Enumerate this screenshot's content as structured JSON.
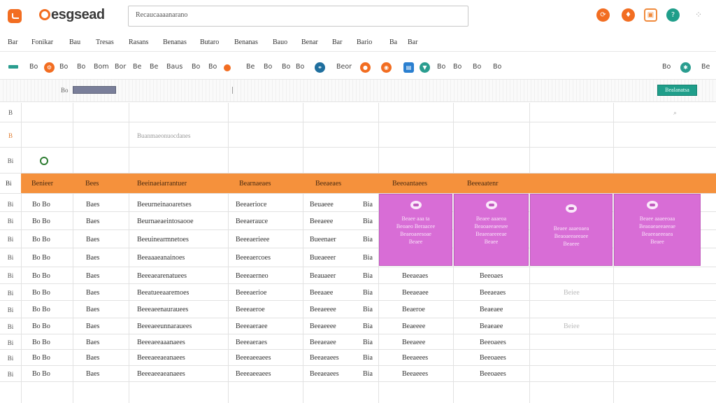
{
  "app": {
    "brand": "esgsead",
    "search_value": "Recaucaaaanarano",
    "top_icons": [
      {
        "name": "sync-icon",
        "glyph": "⟳",
        "color": "#f26d21"
      },
      {
        "name": "bell-icon",
        "glyph": "♦",
        "color": "#f26d21"
      },
      {
        "name": "calendar-icon",
        "glyph": "▣",
        "color": "#f08a3c"
      },
      {
        "name": "help-icon",
        "glyph": "?",
        "color": "#1f9e8a"
      }
    ],
    "grid_glyph": "⁘"
  },
  "menu": [
    "Bar",
    "Fonikar",
    "Bau",
    "Tresas",
    "Rasans",
    "Benanas",
    "Butaro",
    "Benanas",
    "Bauo",
    "Benar",
    "Bar",
    "Bario",
    "Ba",
    "Bar"
  ],
  "toolbar": {
    "items": [
      "Bo",
      "Bo",
      "Bo",
      "Bo",
      "Bom",
      "Bor",
      "Be",
      "Be",
      "Baus",
      "Bo",
      "Bo",
      "Be",
      "Bo",
      "Bo",
      "Bo",
      "Beor",
      "Bo",
      "Bo",
      "Bo",
      "Bo",
      "Bo",
      "Bo",
      "Bo",
      "Bo",
      "Bo",
      "Be"
    ],
    "round_icons": [
      {
        "name": "format-paint-icon",
        "glyph": "⚙",
        "color": "#f26d21"
      },
      {
        "name": "link-icon",
        "glyph": "⚭",
        "color": "#1f6f9e"
      },
      {
        "name": "comment-icon",
        "glyph": "●",
        "color": "#f26d21"
      },
      {
        "name": "image-icon",
        "glyph": "◉",
        "color": "#f26d21"
      },
      {
        "name": "chart-icon",
        "glyph": "▤",
        "color": "#2a7fd0"
      },
      {
        "name": "filter-icon",
        "glyph": "▼",
        "color": "#2a9d8f"
      },
      {
        "name": "settings-icon",
        "glyph": "✱",
        "color": "#2a9d8f"
      }
    ]
  },
  "formula_bar": {
    "cell_ref": "Bo",
    "share_label": "Bealanatsa"
  },
  "sheet": {
    "row_numbers": [
      "B",
      "B",
      "Bi",
      "Bi",
      "Bi",
      "Bi",
      "Bi",
      "Bi",
      "Bi",
      "Bi",
      "Bi",
      "Bi",
      "Bi",
      "Bi"
    ],
    "pre_row_text": "Buanmaeonuocdanes",
    "header_row_label": "Bi",
    "headers": [
      "Benieer",
      "Bees",
      "Beeinaeiarrantuer",
      "Bearnaeaes",
      "Beeaeaes",
      "Beeoantaees",
      "Beeeaatenr"
    ],
    "rows": [
      [
        "Bo Bo",
        "Baes",
        "Beeurneinaoaretses",
        "Beeaerioce",
        "Beuaeee",
        "Bia",
        "",
        "",
        "",
        ""
      ],
      [
        "Bo Bo",
        "Baes",
        "Beurnaeaeintosaooe",
        "Beeaerauce",
        "Beeaeee",
        "Bia",
        "",
        "",
        "",
        ""
      ],
      [
        "Bo Bo",
        "Baes",
        "Beeuinearmnetoes",
        "Beeeaerieee",
        "Bueenaer",
        "Bia",
        "",
        "",
        "",
        ""
      ],
      [
        "Bo Bo",
        "Baes",
        "Beeaaaeanainoes",
        "Beeeaercoes",
        "Bueaeeer",
        "Bia",
        "",
        "",
        "",
        ""
      ],
      [
        "Bo Bo",
        "Baes",
        "Beeeaearenatuees",
        "Beeeaerneo",
        "Beauaeer",
        "Bia",
        "Beeaeaes",
        "Beeoaes",
        "",
        ""
      ],
      [
        "Bo Bo",
        "Baes",
        "Beeatueeaaremoes",
        "Beeeaerioe",
        "Beeaaee",
        "Bia",
        "Beeaeaee",
        "Beeaeaes",
        "Beiee",
        ""
      ],
      [
        "Bo Bo",
        "Baes",
        "Beeeaeenaurauees",
        "Beeeaeroe",
        "Beeaeeee",
        "Bia",
        "Beaeroe",
        "Beaeaee",
        "",
        ""
      ],
      [
        "Bo Bo",
        "Baes",
        "Beeeaeeunnarauees",
        "Beeeaeraee",
        "Beeaeeee",
        "Bia",
        "Beaeeee",
        "Beaeaee",
        "Beiee",
        ""
      ],
      [
        "Bo Bo",
        "Baes",
        "Beeeaeeaaanaees",
        "Beeeaeraes",
        "Beeaeaee",
        "Bia",
        "Beeaeee",
        "Beeoaees",
        "",
        ""
      ],
      [
        "Bo Bo",
        "Baes",
        "Beeeaeeaeanaees",
        "Beeeaeeaees",
        "Beeaeaees",
        "Bia",
        "Beeaeees",
        "Beeoaees",
        "",
        ""
      ],
      [
        "Bo Bo",
        "Baes",
        "Beeeaeeaeanaees",
        "Beeeaeeaees",
        "Beeaeaees",
        "Bia",
        "Beeaeees",
        "Beeoaees",
        "",
        ""
      ]
    ],
    "cards": [
      {
        "lines": [
          "Beaee aaa ta",
          "Beoaeo Beraacee",
          "Beaeoaeesoae",
          "Beaee"
        ]
      },
      {
        "lines": [
          "Beaee aaaeoa",
          "Beaoaeeaeesee",
          "Beaeeaeeeeae",
          "Beaee"
        ]
      },
      {
        "lines": [
          "Beaee aaaeoaea",
          "Beaoaeeaeeaee",
          "Beaeee"
        ]
      },
      {
        "lines": [
          "Beaee aaaeeoaa",
          "Beaoaeaeeaeeae",
          "Beaeeaeeeaea",
          "Beaee"
        ]
      }
    ]
  }
}
